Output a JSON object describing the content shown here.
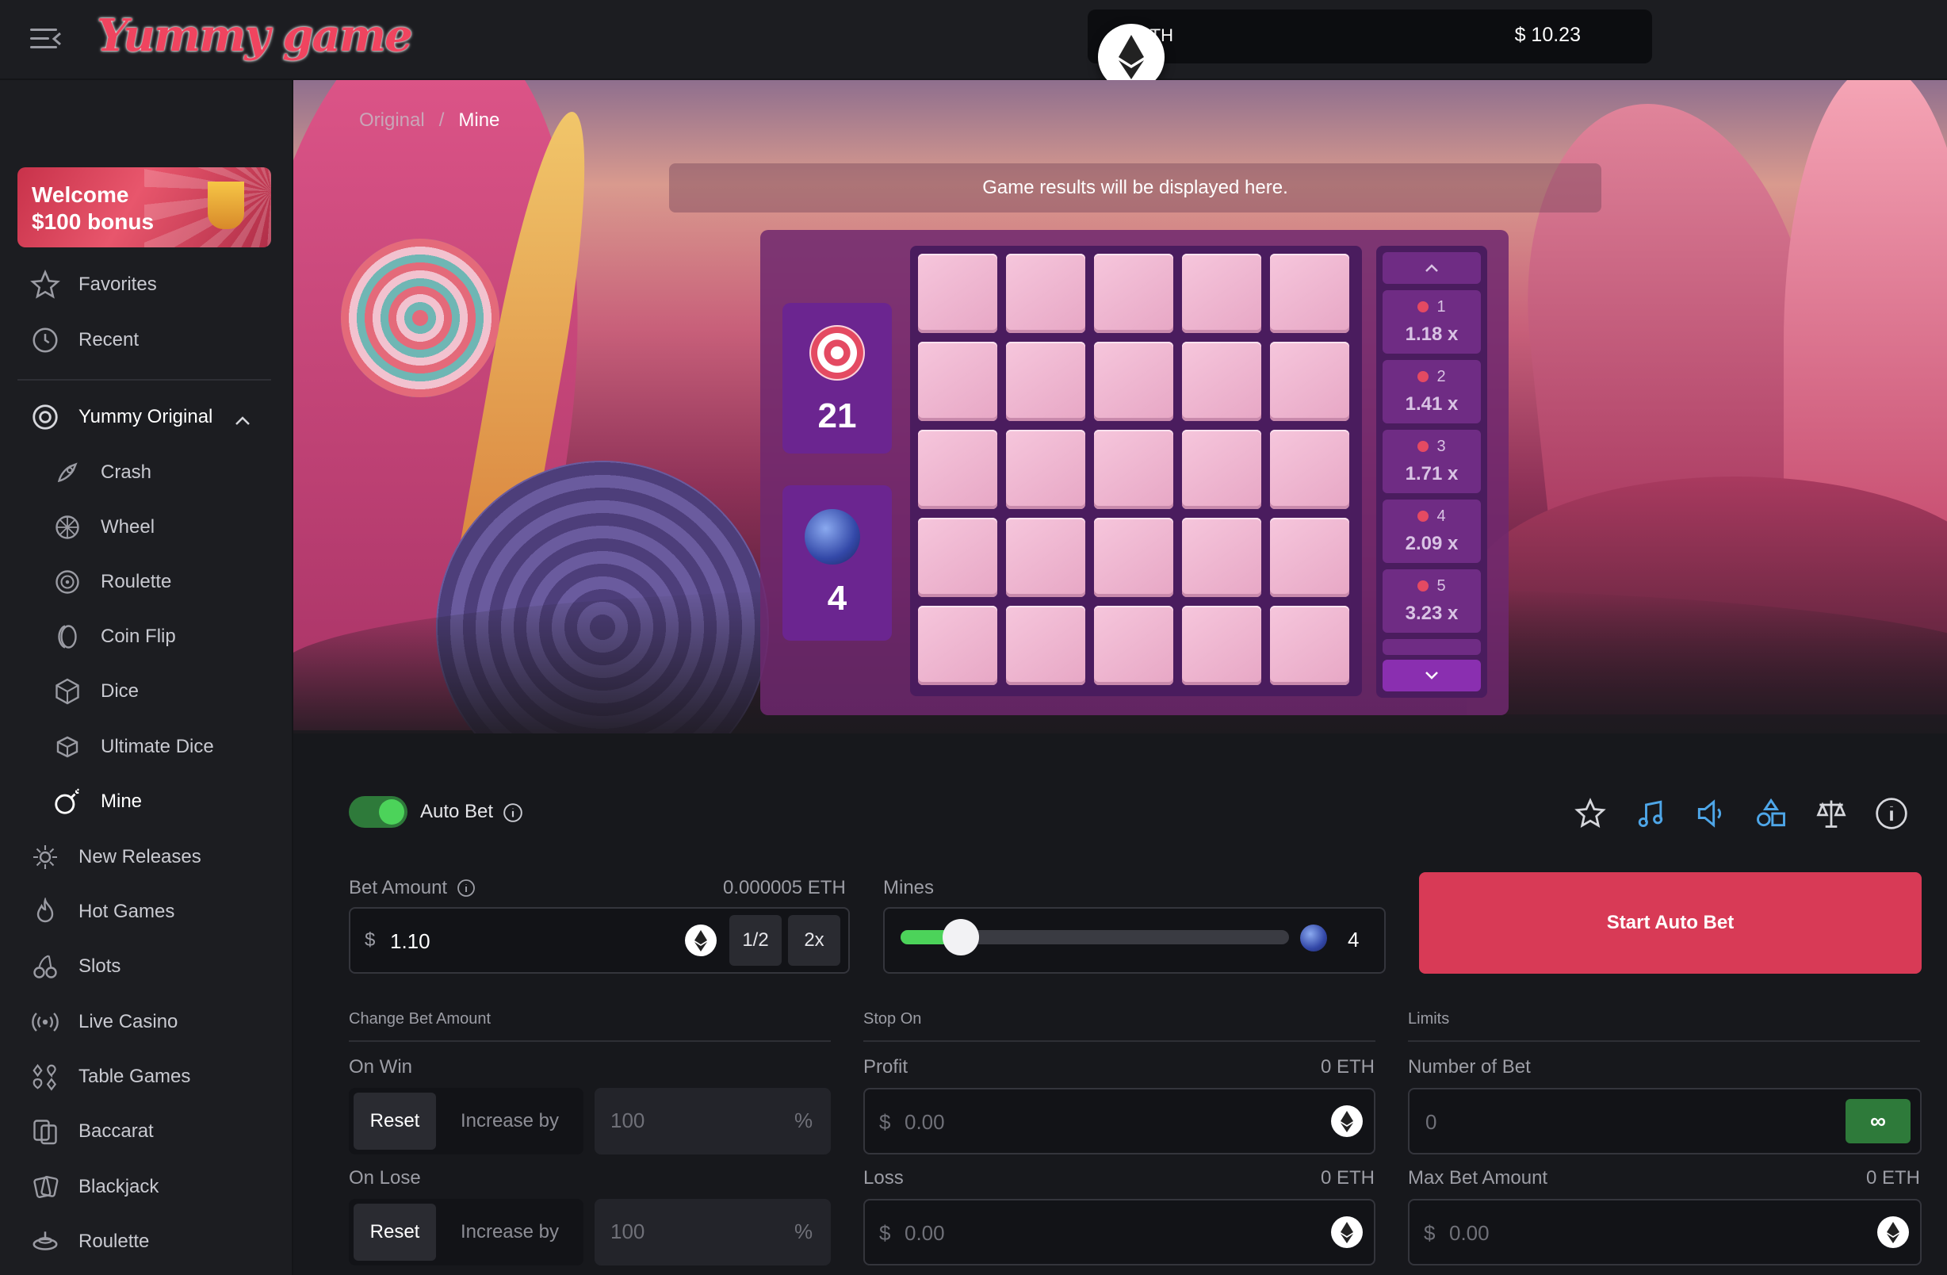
{
  "header": {
    "logo_text": "Yummy game",
    "wallet_currency": "ETH",
    "wallet_balance": "$ 10.23"
  },
  "sidebar": {
    "promo_line1": "Welcome",
    "promo_line2": "$100 bonus",
    "items": [
      {
        "label": "Favorites",
        "icon": "star-icon"
      },
      {
        "label": "Recent",
        "icon": "history-icon"
      },
      {
        "label": "Yummy Original",
        "icon": "original-icon"
      },
      {
        "label": "Crash",
        "icon": "rocket-icon"
      },
      {
        "label": "Wheel",
        "icon": "wheel-icon"
      },
      {
        "label": "Roulette",
        "icon": "roulette-icon"
      },
      {
        "label": "Coin Flip",
        "icon": "coin-icon"
      },
      {
        "label": "Dice",
        "icon": "dice-icon"
      },
      {
        "label": "Ultimate Dice",
        "icon": "ultimate-dice-icon"
      },
      {
        "label": "Mine",
        "icon": "bomb-icon"
      },
      {
        "label": "New Releases",
        "icon": "sparkle-icon"
      },
      {
        "label": "Hot Games",
        "icon": "flame-icon"
      },
      {
        "label": "Slots",
        "icon": "cherry-icon"
      },
      {
        "label": "Live Casino",
        "icon": "broadcast-icon"
      },
      {
        "label": "Table Games",
        "icon": "cards-suits-icon"
      },
      {
        "label": "Baccarat",
        "icon": "baccarat-icon"
      },
      {
        "label": "Blackjack",
        "icon": "blackjack-icon"
      },
      {
        "label": "Roulette",
        "icon": "roulette-table-icon"
      }
    ]
  },
  "game": {
    "breadcrumb_parent": "Original",
    "breadcrumb_separator": "/",
    "breadcrumb_current": "Mine",
    "result_message": "Game results will be displayed here.",
    "gems_count": "21",
    "mines_count": "4",
    "tiles_total": 25,
    "multipliers": [
      {
        "n": "1",
        "m": "1.18 x"
      },
      {
        "n": "2",
        "m": "1.41 x"
      },
      {
        "n": "3",
        "m": "1.71 x"
      },
      {
        "n": "4",
        "m": "2.09 x"
      },
      {
        "n": "5",
        "m": "3.23 x"
      }
    ]
  },
  "controls": {
    "auto_bet_label": "Auto Bet",
    "auto_bet_on": true,
    "bet_amount_label": "Bet Amount",
    "bet_amount_eth": "0.000005 ETH",
    "bet_currency_symbol": "$",
    "bet_amount_value": "1.10",
    "half_label": "1/2",
    "double_label": "2x",
    "mines_label": "Mines",
    "mines_value": "4",
    "mines_slider_fraction": 0.12,
    "start_button": "Start Auto Bet",
    "change_bet_heading": "Change Bet Amount",
    "stop_on_heading": "Stop On",
    "limits_heading": "Limits",
    "on_win_label": "On Win",
    "on_lose_label": "On Lose",
    "reset_label": "Reset",
    "increase_label": "Increase by",
    "percent_value": "100",
    "percent_symbol": "%",
    "profit_label": "Profit",
    "profit_eth": "0 ETH",
    "loss_label": "Loss",
    "loss_eth": "0 ETH",
    "money_placeholder": "0.00",
    "number_of_bet_label": "Number of Bet",
    "number_of_bet_value": "0",
    "infinity_label": "∞",
    "max_bet_label": "Max Bet Amount",
    "max_bet_eth": "0 ETH"
  },
  "colors": {
    "accent": "#d83a56",
    "toggle_on": "#4cd35a",
    "sidebar_bg": "#1c1d21",
    "panel_bg": "#121317"
  }
}
